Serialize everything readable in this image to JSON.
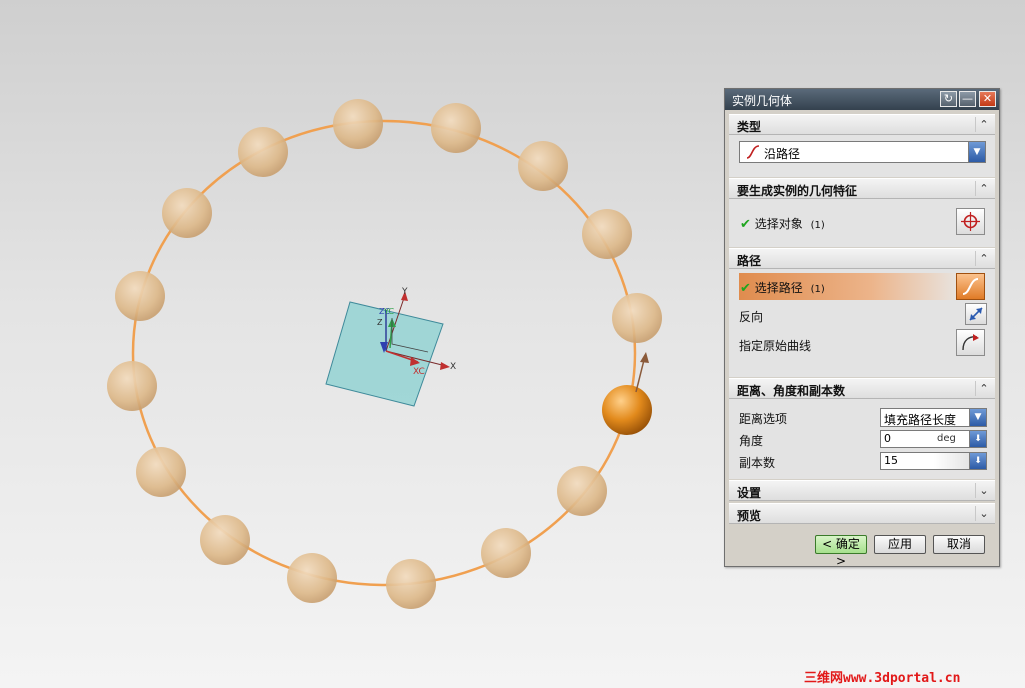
{
  "dialog": {
    "title": "实例几何体",
    "title_buttons": [
      "reset",
      "minimize",
      "close"
    ],
    "sections": {
      "type": {
        "header": "类型",
        "selected": "沿路径"
      },
      "features": {
        "header": "要生成实例的几何特征",
        "select_label": "选择对象",
        "select_count": "(1)"
      },
      "path": {
        "header": "路径",
        "select_label": "选择路径",
        "select_count": "(1)",
        "reverse_label": "反向",
        "origin_curve_label": "指定原始曲线"
      },
      "distance": {
        "header": "距离、角度和副本数",
        "distance_option_label": "距离选项",
        "distance_option_value": "填充路径长度",
        "angle_label": "角度",
        "angle_value": "0",
        "angle_unit": "deg",
        "copies_label": "副本数",
        "copies_value": "15"
      },
      "settings": {
        "header": "设置"
      },
      "preview": {
        "header": "预览"
      }
    },
    "buttons": {
      "ok": "< 确定 >",
      "apply": "应用",
      "cancel": "取消"
    }
  },
  "viewport": {
    "axis_labels": {
      "y": "Y",
      "x": "X",
      "zc": "ZC",
      "yc": "YC",
      "xc": "XC",
      "z": "Z"
    }
  },
  "watermark": "三维网www.3dportal.cn",
  "colors": {
    "accent_orange": "#e07b27",
    "sphere_ghost": "#e6c49a",
    "plane_fill": "#8fd2d2",
    "check_green": "#1fa51f"
  }
}
